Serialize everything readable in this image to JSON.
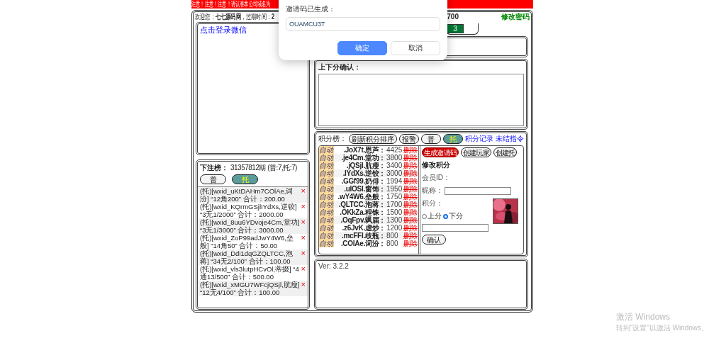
{
  "notice_bar": {
    "text": "注意！注意！注意！请认准本公司域名为"
  },
  "header": {
    "welcome": "欢迎您：**七七源码网**，过期时间：**2**",
    "right_text": "700",
    "change_password": "修改密码"
  },
  "login_panel": {
    "link": "点击登录微信"
  },
  "bet_panel": {
    "title": "下注榜：",
    "period": "31357812期 (普:7,托:7)",
    "filters": [
      {
        "label": "普",
        "selected": false
      },
      {
        "label": "托",
        "selected": true
      }
    ],
    "entries": [
      {
        "text": "(托)[wxid_uKtDAHm7COlAe,词汾] “12角200” 合计：200.00",
        "delete": "×"
      },
      {
        "text": "(托)[wxid_KQrmGSjlIYdXs,逆铰] “3无1/2000” 合计：2000.00",
        "delete": "×"
      },
      {
        "text": "(托)[wxid_8uu6YDvoje4Cm,堂功] “3无1/3000” 合计：3000.00",
        "delete": "×"
      },
      {
        "text": "(托)[wxid_ZoP99adJwY4W6,垒般] “14角50” 合计：50.00",
        "delete": "×"
      },
      {
        "text": "(托)[wxid_Ddi1dqGZQLTCC,泡蒋] “34无2/100” 合计：100.00",
        "delete": "×"
      },
      {
        "text": "(托)[wxid_vls3lutpHCvOl,蒂掇] “4通13/500” 合计：500.00",
        "delete": "×"
      },
      {
        "text": "(托)[wxid_xMGU7WFcjQSjl,肮瘦] “12无4/100” 合计：100.00",
        "delete": "×"
      }
    ]
  },
  "tab_strip": {
    "badge": "3"
  },
  "confirm_panel": {
    "title": "上下分确认："
  },
  "score_panel": {
    "title": "积分榜：",
    "toolbar": [
      {
        "kind": "button",
        "label": "刷新积分排序"
      },
      {
        "kind": "button",
        "label": "报警"
      },
      {
        "kind": "toggle",
        "label": "普",
        "selected": false
      },
      {
        "kind": "toggle",
        "label": "托",
        "selected": true
      },
      {
        "kind": "link",
        "label": "积分记录"
      },
      {
        "kind": "link",
        "label": "未结指令"
      }
    ],
    "rows": [
      {
        "mode": "自动",
        "name": ".JoX7t.恩芦：",
        "score": "4425",
        "delete": "删除"
      },
      {
        "mode": "自动",
        "name": ".je4Cm.堂功：",
        "score": "3800",
        "delete": "删除"
      },
      {
        "mode": "自动",
        "name": ".jQSjl.肮瘦：",
        "score": "3400",
        "delete": "删除"
      },
      {
        "mode": "自动",
        "name": ".lYdXs.逆铰：",
        "score": "3000",
        "delete": "删除"
      },
      {
        "mode": "自动",
        "name": ".GGf99.奶俳：",
        "score": "1994",
        "delete": "删除"
      },
      {
        "mode": "自动",
        "name": ".ulOSl.窗饰：",
        "score": "1950",
        "delete": "删除"
      },
      {
        "mode": "自动",
        "name": ".wY4W6.垒般：",
        "score": "1750",
        "delete": "删除"
      },
      {
        "mode": "自动",
        "name": ".QLTCC.泡蒋：",
        "score": "1700",
        "delete": "删除"
      },
      {
        "mode": "自动",
        "name": ".OKkZa.程铢：",
        "score": "1500",
        "delete": "删除"
      },
      {
        "mode": "自动",
        "name": ".OqFpv.飒届：",
        "score": "1300",
        "delete": "删除"
      },
      {
        "mode": "自动",
        "name": ".z6JvK.虐炒：",
        "score": "1200",
        "delete": "删除"
      },
      {
        "mode": "自动",
        "name": ".mcFFl.歧瓶：",
        "score": "800",
        "delete": "删除"
      },
      {
        "mode": "自动",
        "name": ".COlAe.词汾：",
        "score": "800",
        "delete": "删除"
      }
    ],
    "actions": [
      {
        "kind": "primary",
        "label": "生成邀请码"
      },
      {
        "kind": "normal",
        "label": "创建玩家"
      },
      {
        "kind": "normal",
        "label": "创建托"
      }
    ],
    "form": {
      "title": "修改积分",
      "member_id_label": "会员ID：",
      "nickname_label": "昵称：",
      "score_label": "积分：",
      "radios": [
        {
          "label": "上分",
          "selected": false
        },
        {
          "label": "下分",
          "selected": true
        }
      ],
      "confirm": "确认"
    }
  },
  "version": "Ver: 3.2.2",
  "dialog": {
    "label": "邀请码已生成：",
    "value": "OUAMCU3T",
    "buttons": [
      {
        "label": "确定",
        "kind": "primary"
      },
      {
        "label": "取消",
        "kind": "secondary"
      }
    ]
  },
  "watermark": {
    "title": "激活 Windows",
    "subtitle": "转到“设置”以激活 Windows。"
  }
}
